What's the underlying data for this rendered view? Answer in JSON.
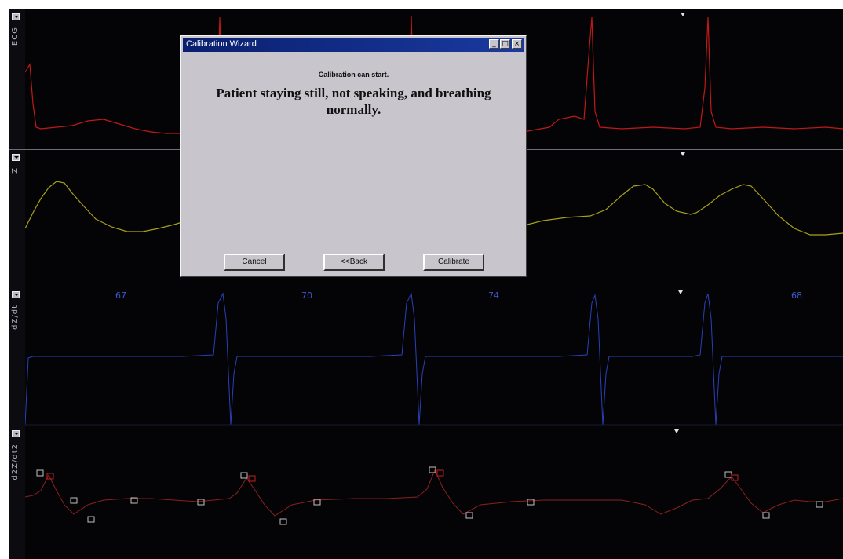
{
  "channels": [
    {
      "name": "ECG",
      "trace_color": "#c01818"
    },
    {
      "name": "Z",
      "trace_color": "#a8a018"
    },
    {
      "name": "dZ/dt",
      "trace_color": "#2a40b8"
    },
    {
      "name": "d2Z/dt2",
      "trace_color": "#8a2020"
    }
  ],
  "heart_rates": [
    "67",
    "70",
    "74",
    "68"
  ],
  "dialog": {
    "title": "Calibration Wizard",
    "status": "Calibration can start.",
    "message": "Patient staying still, not speaking, and breathing normally.",
    "buttons": {
      "cancel": "Cancel",
      "back": "<<Back",
      "calibrate": "Calibrate"
    },
    "titlebar_buttons": [
      "_",
      "□",
      "×"
    ]
  }
}
